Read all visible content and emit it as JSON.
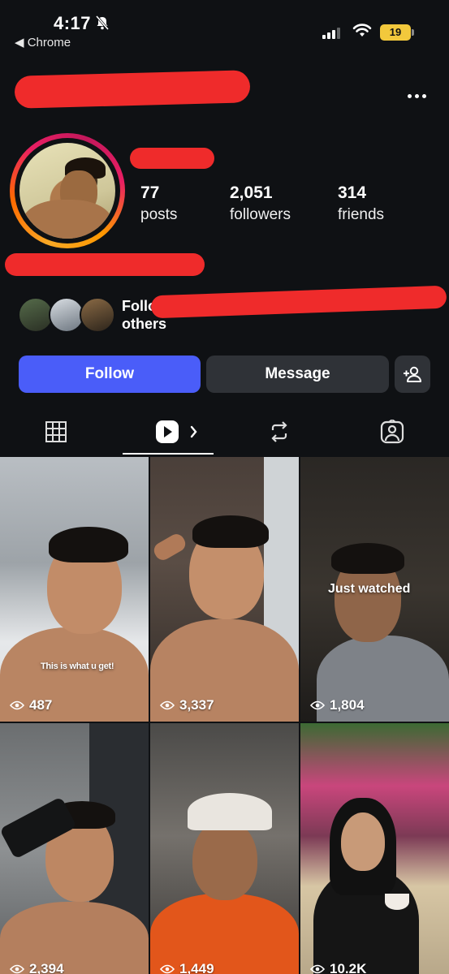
{
  "status_bar": {
    "time": "4:17",
    "back_app": "◀ Chrome",
    "battery": "19",
    "battery_color": "#f2c83c"
  },
  "profile": {
    "stats": [
      {
        "value": "77",
        "label": "posts"
      },
      {
        "value": "2,051",
        "label": "followers"
      },
      {
        "value": "314",
        "label": "friends"
      }
    ],
    "followed_by_line1": "Follo",
    "followed_by_line2": "others",
    "ring_colors": [
      "#f9a825",
      "#e91e63"
    ]
  },
  "actions": {
    "follow": "Follow",
    "message": "Message",
    "follow_color": "#4a5df9"
  },
  "tabs": [
    "grid-icon",
    "reels-icon",
    "reposts-icon",
    "tagged-icon"
  ],
  "grid": {
    "tiles": [
      {
        "views": "487",
        "caption": "This is what u get!"
      },
      {
        "views": "3,337",
        "caption": ""
      },
      {
        "views": "1,804",
        "caption": "Just watched"
      },
      {
        "views": "2,394",
        "caption": ""
      },
      {
        "views": "1,449",
        "caption": ""
      },
      {
        "views": "10.2K",
        "caption": ""
      }
    ]
  }
}
